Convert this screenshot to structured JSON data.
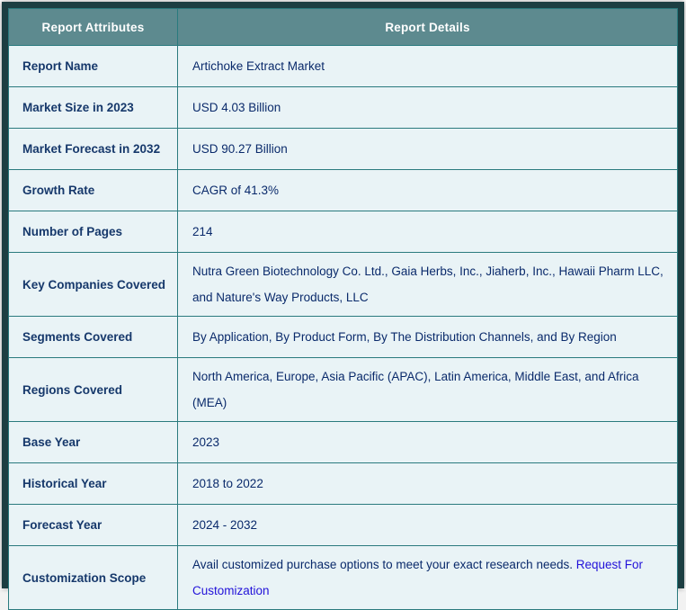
{
  "header": {
    "attributes": "Report Attributes",
    "details": "Report Details"
  },
  "rows": [
    {
      "attribute": "Report Name",
      "detail": "Artichoke Extract Market"
    },
    {
      "attribute": "Market Size in 2023",
      "detail": "USD 4.03 Billion"
    },
    {
      "attribute": "Market Forecast in 2032",
      "detail": "USD 90.27 Billion"
    },
    {
      "attribute": "Growth Rate",
      "detail": "CAGR of 41.3%"
    },
    {
      "attribute": "Number of Pages",
      "detail": "214"
    },
    {
      "attribute": "Key Companies Covered",
      "detail": "Nutra Green Biotechnology Co. Ltd., Gaia Herbs, Inc., Jiaherb, Inc., Hawaii Pharm LLC, and Nature's Way Products, LLC"
    },
    {
      "attribute": "Segments Covered",
      "detail": "By Application, By Product Form, By The Distribution Channels, and By Region"
    },
    {
      "attribute": "Regions Covered",
      "detail": "North America, Europe, Asia Pacific (APAC), Latin America, Middle East, and Africa (MEA)"
    },
    {
      "attribute": "Base Year",
      "detail": "2023"
    },
    {
      "attribute": "Historical Year",
      "detail": "2018 to 2022"
    },
    {
      "attribute": "Forecast Year",
      "detail": "2024 - 2032"
    },
    {
      "attribute": "Customization Scope",
      "detail": "Avail customized purchase options to meet your exact research needs.",
      "link": "Request For Customization"
    }
  ],
  "colors": {
    "frame_border": "#1c3e42",
    "header_bg": "#5d8a8f",
    "header_text": "#ffffff",
    "cell_border": "#2a7a7e",
    "row_bg": "#e9f3f6",
    "attribute_text": "#16386b",
    "detail_text": "#0a2a6b",
    "link_text": "#2212d9"
  }
}
